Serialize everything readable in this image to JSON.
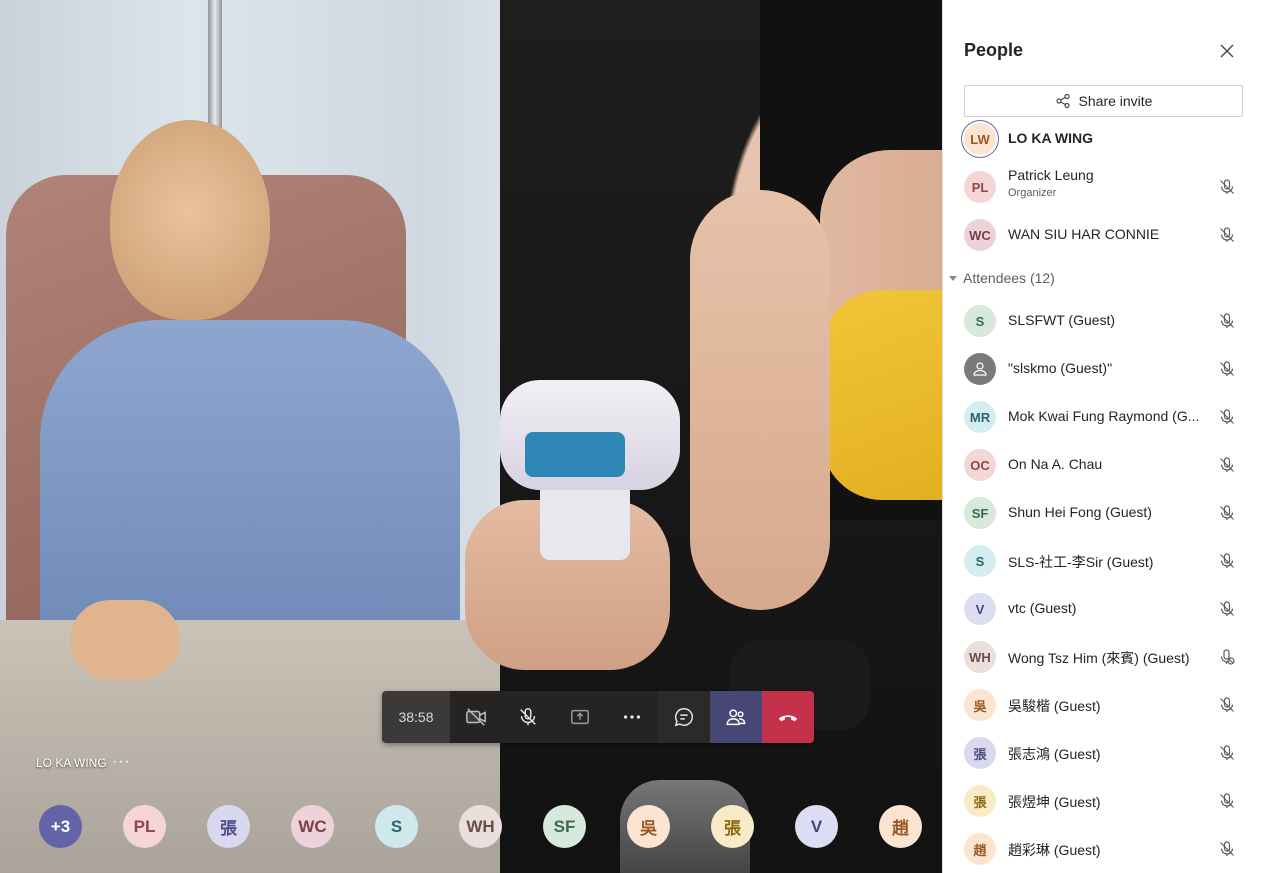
{
  "call": {
    "timer": "38:58",
    "self_name": "LO KA WING",
    "self_more": "···",
    "controls": [
      {
        "name": "camera-toggle-button",
        "icon": "camera-off-icon"
      },
      {
        "name": "mic-toggle-button",
        "icon": "mic-off-icon"
      },
      {
        "name": "share-screen-button",
        "icon": "share-tray-icon"
      },
      {
        "name": "more-actions-button",
        "icon": "more-icon"
      },
      {
        "name": "chat-button",
        "icon": "chat-icon"
      },
      {
        "name": "participants-button",
        "icon": "people-icon"
      },
      {
        "name": "hang-up-button",
        "icon": "hang-up-icon"
      }
    ]
  },
  "avatar_strip": [
    {
      "label": "+3",
      "bg": "#6264a7",
      "fg": "#ffffff"
    },
    {
      "label": "PL",
      "bg": "#f5d5d5",
      "fg": "#8a4a4a"
    },
    {
      "label": "張",
      "bg": "#d9d8ef",
      "fg": "#4f4e85"
    },
    {
      "label": "WC",
      "bg": "#edd3d9",
      "fg": "#7a3f4c"
    },
    {
      "label": "S",
      "bg": "#cfe8ec",
      "fg": "#2c6470"
    },
    {
      "label": "WH",
      "bg": "#eadfdd",
      "fg": "#6b4d48"
    },
    {
      "label": "SF",
      "bg": "#d7e8dc",
      "fg": "#3d6b4a"
    },
    {
      "label": "吳",
      "bg": "#fbe4d0",
      "fg": "#9a5a26"
    },
    {
      "label": "張",
      "bg": "#f8ebc6",
      "fg": "#8a6a14"
    },
    {
      "label": "V",
      "bg": "#dcdcf2",
      "fg": "#45457f"
    },
    {
      "label": "趙",
      "bg": "#fbe4d0",
      "fg": "#9a5a26"
    }
  ],
  "panel": {
    "title": "People",
    "share_invite": "Share invite",
    "attendees_header": "Attendees (12)",
    "presenters": [
      {
        "initials": "LW",
        "name": "LO KA WING",
        "role": "",
        "bg": "#fbe4d0",
        "fg": "#9a5a26",
        "bold": true,
        "muted": false,
        "ring": true
      },
      {
        "initials": "PL",
        "name": "Patrick Leung",
        "role": "Organizer",
        "bg": "#f5d5d5",
        "fg": "#8a4a4a",
        "muted": true
      },
      {
        "initials": "WC",
        "name": "WAN SIU HAR CONNIE",
        "role": "",
        "bg": "#edd3d9",
        "fg": "#7a3f4c",
        "muted": true
      }
    ],
    "attendees": [
      {
        "initials": "S",
        "name": "SLSFWT (Guest)",
        "bg": "#d7e8dc",
        "fg": "#3d6b4a",
        "icon": "mic-off-icon"
      },
      {
        "initials": "",
        "name": "\"slskmo (Guest)\"",
        "bg": "#7a7a7a",
        "fg": "#ffffff",
        "icon": "mic-off-icon",
        "person": true
      },
      {
        "initials": "MR",
        "name": "Mok Kwai Fung Raymond (G...",
        "bg": "#d4eef0",
        "fg": "#2c6470",
        "icon": "mic-off-icon"
      },
      {
        "initials": "OC",
        "name": "On Na A. Chau",
        "bg": "#f3d6d6",
        "fg": "#8a4a4a",
        "icon": "mic-off-icon"
      },
      {
        "initials": "SF",
        "name": "Shun Hei Fong (Guest)",
        "bg": "#d7e8dc",
        "fg": "#3d6b4a",
        "icon": "mic-off-icon"
      },
      {
        "initials": "S",
        "name": "SLS-社工-李Sir (Guest)",
        "bg": "#d4eef0",
        "fg": "#2c6470",
        "icon": "mic-off-icon"
      },
      {
        "initials": "V",
        "name": "vtc (Guest)",
        "bg": "#dcdcf2",
        "fg": "#45457f",
        "icon": "mic-off-icon"
      },
      {
        "initials": "WH",
        "name": "Wong Tsz Him (來賓) (Guest)",
        "bg": "#eadfdd",
        "fg": "#6b4d48",
        "icon": "mic-blocked-icon"
      },
      {
        "initials": "吳",
        "name": "吳駿楷 (Guest)",
        "bg": "#fbe4d0",
        "fg": "#9a5a26",
        "icon": "mic-off-icon"
      },
      {
        "initials": "張",
        "name": "張志鴻 (Guest)",
        "bg": "#d9d8ef",
        "fg": "#4f4e85",
        "icon": "mic-off-icon"
      },
      {
        "initials": "張",
        "name": "張煜坤 (Guest)",
        "bg": "#f8ebc6",
        "fg": "#8a6a14",
        "icon": "mic-off-icon"
      },
      {
        "initials": "趙",
        "name": "趙彩琳 (Guest)",
        "bg": "#fbe4d0",
        "fg": "#9a5a26",
        "icon": "mic-off-icon"
      }
    ]
  }
}
